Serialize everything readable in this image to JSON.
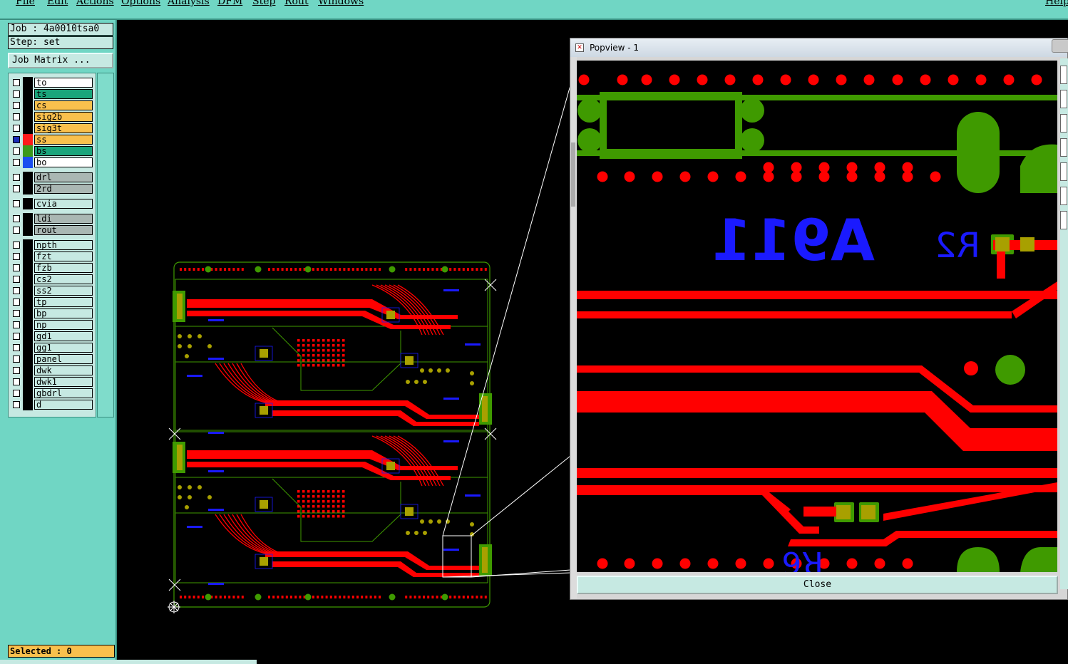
{
  "menu": [
    "File",
    "Edit",
    "Actions",
    "Options",
    "Analysis",
    "DFM",
    "Step",
    "Rout",
    "Windows"
  ],
  "help": "Help",
  "job": {
    "label": "Job : 4a0010tsa0",
    "step": "Step: set",
    "matrix_button": "Job Matrix ..."
  },
  "layers": [
    {
      "name": "to",
      "color": "#ffffff",
      "swatch": "#000000",
      "checked": false
    },
    {
      "name": "ts",
      "color": "#1aa57b",
      "swatch": "#000000",
      "checked": false
    },
    {
      "name": "cs",
      "color": "#f9c04d",
      "swatch": "#000000",
      "checked": false
    },
    {
      "name": "sig2b",
      "color": "#f9c04d",
      "swatch": "#000000",
      "checked": false
    },
    {
      "name": "sig3t",
      "color": "#f9c04d",
      "swatch": "#000000",
      "checked": false
    },
    {
      "name": "ss",
      "color": "#f9c04d",
      "swatch": "#ff1a1a",
      "checked": true
    },
    {
      "name": "bs",
      "color": "#1aa57b",
      "swatch": "#3a9a1a",
      "checked": false
    },
    {
      "name": "bo",
      "color": "#ffffff",
      "swatch": "#1a4df0",
      "checked": false
    }
  ],
  "drill_layers": [
    "drl",
    "2rd"
  ],
  "via_layers": [
    "cvia"
  ],
  "misc_layers": [
    "ldi",
    "rout"
  ],
  "doc_layers": [
    "npth",
    "fzt",
    "fzb",
    "cs2",
    "ss2",
    "tp",
    "bp",
    "np",
    "gd1",
    "gg1",
    "panel",
    "dwk",
    "dwk1",
    "gbdrl",
    "d"
  ],
  "selected": "Selected : 0",
  "popview": {
    "title": "Popview - 1",
    "close_label": "Close",
    "labels": {
      "a911": "A911",
      "r2": "R2",
      "r6": "R6"
    }
  },
  "colors": {
    "copper": "#ff0000",
    "green": "#3f9a00",
    "pad": "#a8a000",
    "text": "#1a1aff",
    "bg": "#000000",
    "panel": "#70d6c4"
  }
}
